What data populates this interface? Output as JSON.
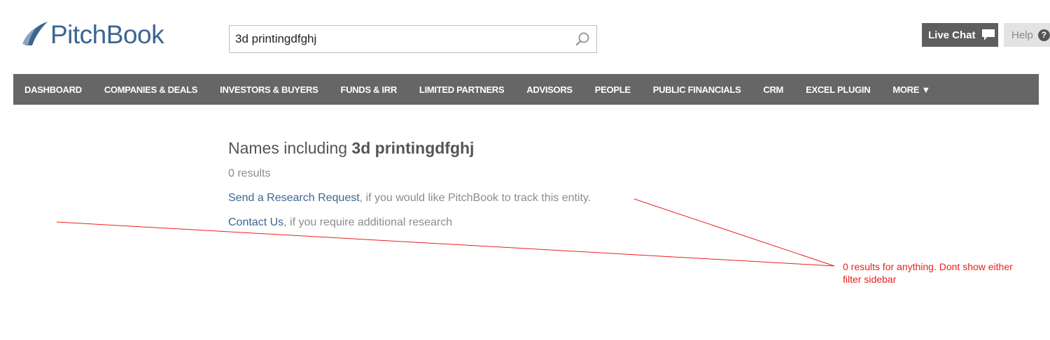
{
  "header": {
    "logo_text": "PitchBook",
    "search": {
      "value": "3d printingdfghj",
      "icon": "search-icon"
    },
    "live_chat_label": "Live Chat",
    "help_label": "Help",
    "help_icon_glyph": "?"
  },
  "nav": {
    "items": [
      {
        "label": "DASHBOARD"
      },
      {
        "label": "COMPANIES & DEALS"
      },
      {
        "label": "INVESTORS & BUYERS"
      },
      {
        "label": "FUNDS & IRR"
      },
      {
        "label": "LIMITED PARTNERS"
      },
      {
        "label": "ADVISORS"
      },
      {
        "label": "PEOPLE"
      },
      {
        "label": "PUBLIC FINANCIALS"
      },
      {
        "label": "CRM"
      },
      {
        "label": "EXCEL PLUGIN"
      },
      {
        "label": "MORE ▼"
      }
    ]
  },
  "results": {
    "title_prefix": "Names including ",
    "query": "3d printingdfghj",
    "count_text": "0 results",
    "research_link": "Send a Research Request",
    "research_suffix": ", if you would like PitchBook to track this entity.",
    "contact_link": "Contact Us",
    "contact_suffix": ", if you require additional research"
  },
  "annotation": {
    "note": "0 results for anything. Dont show either filter sidebar",
    "color": "#e8201a"
  },
  "colors": {
    "brand": "#3d6591",
    "nav_bg": "#666666",
    "live_chat_bg": "#5e5e5e",
    "help_bg": "#e3e3e3"
  }
}
